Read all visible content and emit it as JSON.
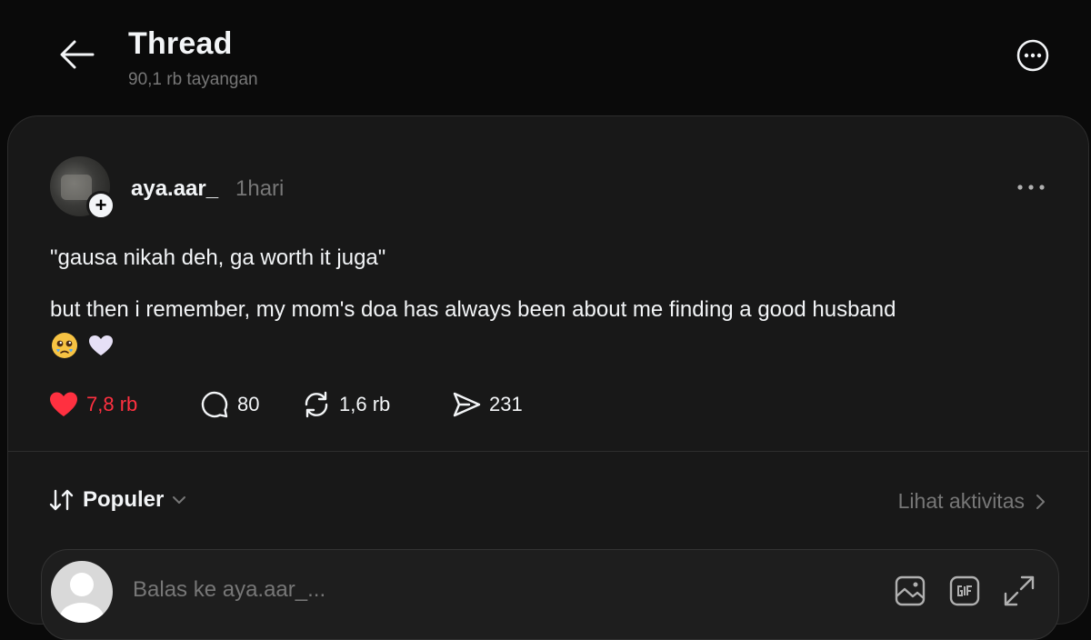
{
  "header": {
    "title": "Thread",
    "subtitle": "90,1 rb tayangan"
  },
  "post": {
    "username": "aya.aar_",
    "time": "1hari",
    "line1": "\"gausa nikah deh, ga worth it juga\"",
    "line2": "but then i remember, my mom's doa has always been about me finding a good husband",
    "emojis": [
      "teary-face-emoji",
      "white-heart-emoji"
    ],
    "actions": {
      "likes": "7,8 rb",
      "replies": "80",
      "reposts": "1,6 rb",
      "shares": "231"
    },
    "liked": true
  },
  "sort": {
    "label": "Populer"
  },
  "activity": {
    "label": "Lihat aktivitas"
  },
  "reply": {
    "placeholder": "Balas ke aya.aar_..."
  },
  "colors": {
    "background": "#0a0a0a",
    "card": "#181818",
    "like": "#ff3040",
    "muted": "#777777",
    "text": "#f3f5f7"
  }
}
